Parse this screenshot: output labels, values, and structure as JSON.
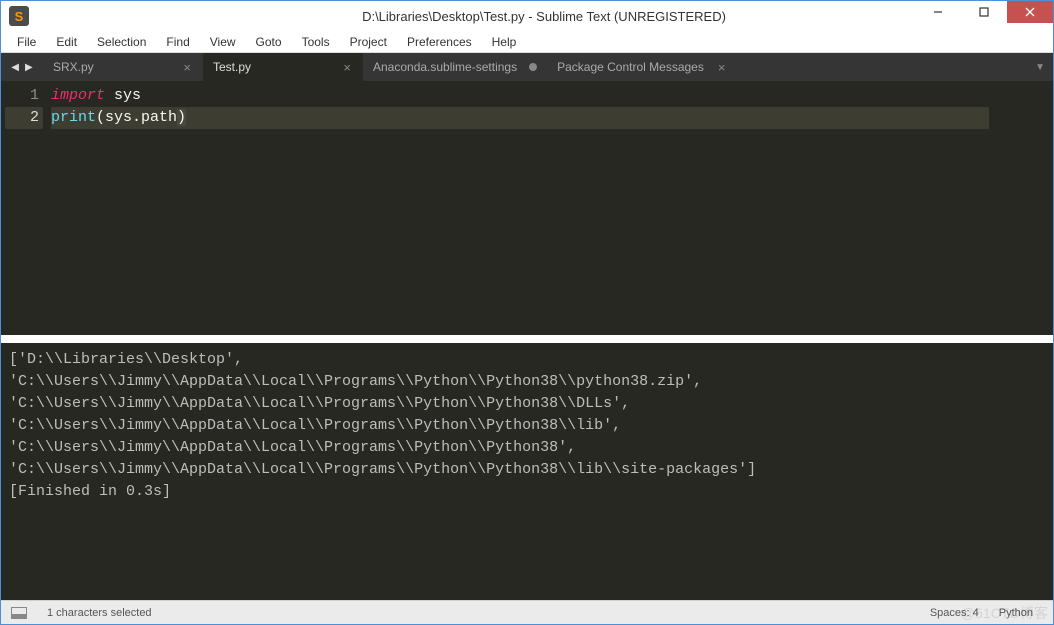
{
  "window": {
    "title": "D:\\Libraries\\Desktop\\Test.py - Sublime Text (UNREGISTERED)"
  },
  "menu": {
    "items": [
      "File",
      "Edit",
      "Selection",
      "Find",
      "View",
      "Goto",
      "Tools",
      "Project",
      "Preferences",
      "Help"
    ]
  },
  "tabs": {
    "items": [
      {
        "label": "SRX.py",
        "active": false,
        "dirty": false
      },
      {
        "label": "Test.py",
        "active": true,
        "dirty": false
      },
      {
        "label": "Anaconda.sublime-settings",
        "active": false,
        "dirty": true
      },
      {
        "label": "Package Control Messages",
        "active": false,
        "dirty": false
      }
    ]
  },
  "editor": {
    "line_numbers": [
      "1",
      "2"
    ],
    "code": {
      "l1_kw": "import",
      "l1_mod": " sys",
      "l2_fn": "print",
      "l2_open": "(",
      "l2_arg": "sys.path",
      "l2_close": ")"
    }
  },
  "output": {
    "lines": [
      "['D:\\\\Libraries\\\\Desktop',",
      "'C:\\\\Users\\\\Jimmy\\\\AppData\\\\Local\\\\Programs\\\\Python\\\\Python38\\\\python38.zip',",
      "'C:\\\\Users\\\\Jimmy\\\\AppData\\\\Local\\\\Programs\\\\Python\\\\Python38\\\\DLLs',",
      "'C:\\\\Users\\\\Jimmy\\\\AppData\\\\Local\\\\Programs\\\\Python\\\\Python38\\\\lib',",
      "'C:\\\\Users\\\\Jimmy\\\\AppData\\\\Local\\\\Programs\\\\Python\\\\Python38',",
      "'C:\\\\Users\\\\Jimmy\\\\AppData\\\\Local\\\\Programs\\\\Python\\\\Python38\\\\lib\\\\site-packages']",
      "[Finished in 0.3s]"
    ]
  },
  "status": {
    "selection": "1 characters selected",
    "spaces": "Spaces: 4",
    "syntax": "Python"
  },
  "watermark": "@51CTO博客"
}
